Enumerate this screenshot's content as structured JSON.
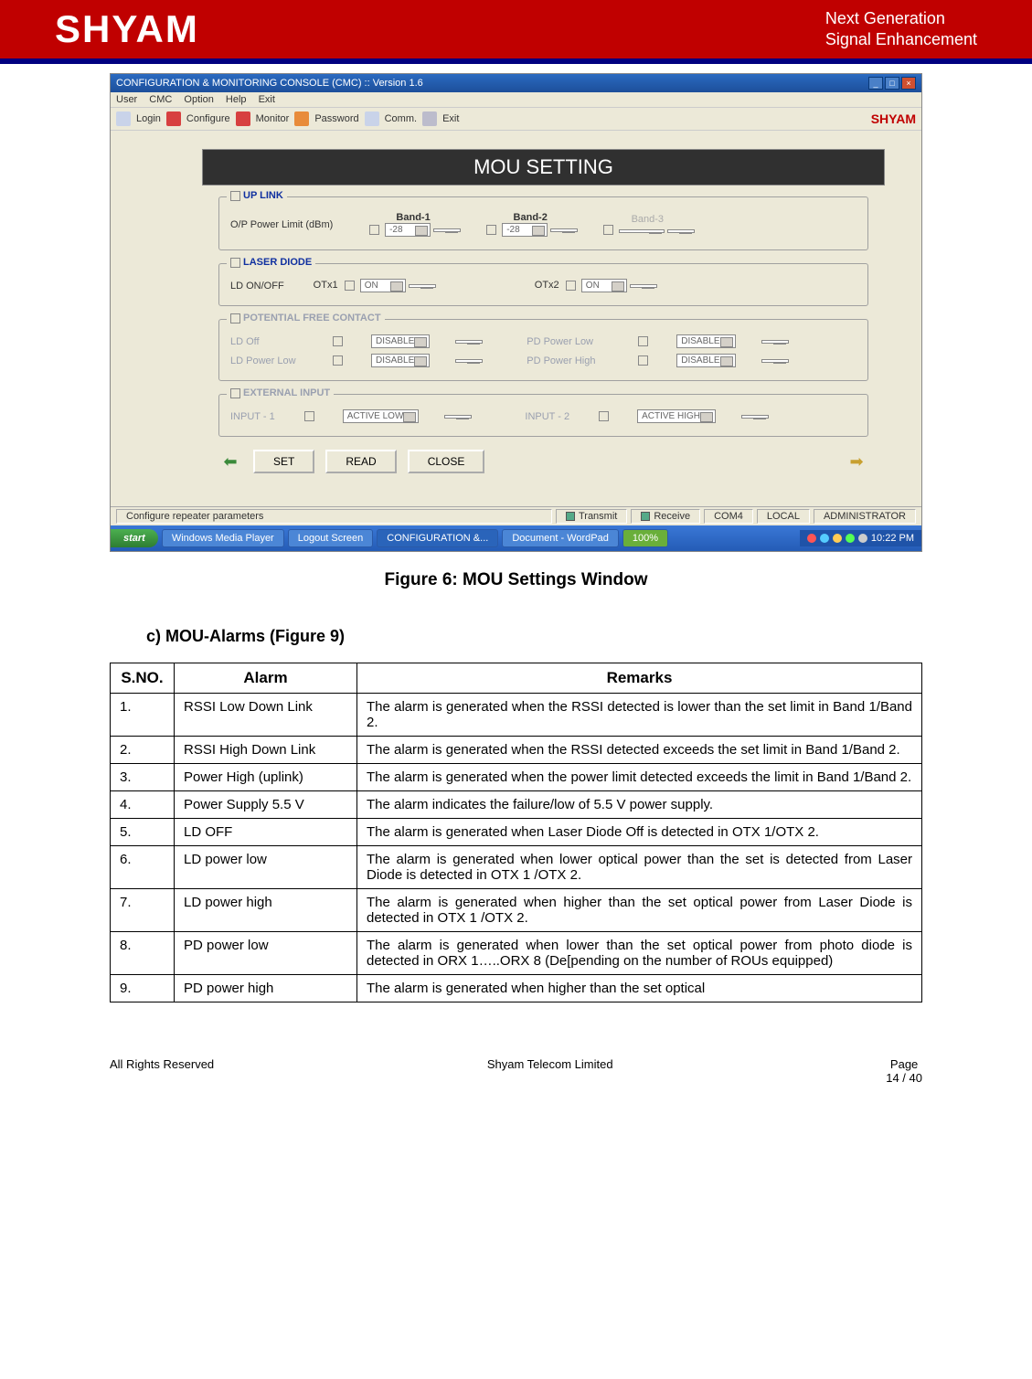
{
  "brand": {
    "logo": "SHYAM",
    "tagline_l1": "Next Generation",
    "tagline_l2": "Signal Enhancement"
  },
  "window": {
    "title": "CONFIGURATION & MONITORING CONSOLE (CMC) :: Version 1.6",
    "menus": {
      "user": "User",
      "cmc": "CMC",
      "option": "Option",
      "help": "Help",
      "exit": "Exit"
    },
    "toolbar": {
      "login": "Login",
      "configure": "Configure",
      "monitor": "Monitor",
      "password": "Password",
      "comm": "Comm.",
      "exit": "Exit",
      "brand": "SHYAM"
    },
    "mou": {
      "header": "MOU SETTING",
      "uplink": {
        "title": "UP LINK",
        "op_label": "O/P Power Limit (dBm)",
        "band1": "Band-1",
        "band2": "Band-2",
        "band3": "Band-3",
        "v1": "-28",
        "v2": "-28",
        "v3": ""
      },
      "laser": {
        "title": "LASER DIODE",
        "ld_label": "LD ON/OFF",
        "otx1": "OTx1",
        "otx2": "OTx2",
        "on1": "ON",
        "on2": "ON"
      },
      "potential": {
        "title": "POTENTIAL FREE CONTACT",
        "ld_off": "LD Off",
        "ld_power_low": "LD Power Low",
        "pd_power_low": "PD Power Low",
        "pd_power_high": "PD Power High",
        "disable": "DISABLE"
      },
      "external": {
        "title": "EXTERNAL INPUT",
        "input1": "INPUT - 1",
        "input2": "INPUT - 2",
        "active_low": "ACTIVE LOW",
        "active_high": "ACTIVE HIGH"
      },
      "buttons": {
        "set": "SET",
        "read": "READ",
        "close": "CLOSE"
      }
    },
    "statusbar": {
      "left": "Configure repeater parameters",
      "transmit": "Transmit",
      "receive": "Receive",
      "com": "COM4",
      "mode": "LOCAL",
      "role": "ADMINISTRATOR"
    },
    "taskbar": {
      "start": "start",
      "t1": "Windows Media Player",
      "t2": "Logout Screen",
      "t3": "CONFIGURATION &...",
      "t4": "Document - WordPad",
      "conn": "100%",
      "time": "10:22 PM"
    }
  },
  "figure_caption": "Figure 6: MOU Settings Window",
  "section_heading": "c) MOU-Alarms (Figure 9)",
  "table": {
    "headers": {
      "sno": "S.NO.",
      "alarm": "Alarm",
      "remarks": "Remarks"
    },
    "rows": [
      {
        "sno": "1.",
        "alarm": "RSSI Low Down Link",
        "remarks": "The alarm is generated when the RSSI detected is lower than the set limit in Band 1/Band 2."
      },
      {
        "sno": "2.",
        "alarm": "RSSI High Down Link",
        "remarks": "The alarm is generated when the RSSI detected exceeds the set limit in Band 1/Band 2."
      },
      {
        "sno": "3.",
        "alarm": "Power High (uplink)",
        "remarks": "The alarm is generated when the power limit detected exceeds the limit in Band 1/Band 2."
      },
      {
        "sno": "4.",
        "alarm": "Power Supply 5.5 V",
        "remarks": "The alarm indicates the failure/low of 5.5 V power supply."
      },
      {
        "sno": "5.",
        "alarm": "LD OFF",
        "remarks": "The alarm is generated when Laser Diode Off is detected in OTX 1/OTX 2."
      },
      {
        "sno": "6.",
        "alarm": "LD power low",
        "remarks": "The alarm is generated when lower optical power than the set is detected from Laser Diode is detected in OTX 1 /OTX 2."
      },
      {
        "sno": "7.",
        "alarm": "LD power high",
        "remarks": "The alarm is generated when higher than the set optical power from Laser Diode is detected in OTX 1 /OTX 2."
      },
      {
        "sno": "8.",
        "alarm": "PD power low",
        "remarks": "The alarm is generated when lower than the set optical power from photo diode is detected in ORX 1…..ORX 8 (De[pending on the number of ROUs equipped)"
      },
      {
        "sno": "9.",
        "alarm": "PD power high",
        "remarks": "The alarm is generated when higher than the set optical"
      }
    ]
  },
  "footer": {
    "left": "All Rights Reserved",
    "center": "Shyam Telecom Limited",
    "right_l1": "Page",
    "right_l2": "14 / 40"
  }
}
